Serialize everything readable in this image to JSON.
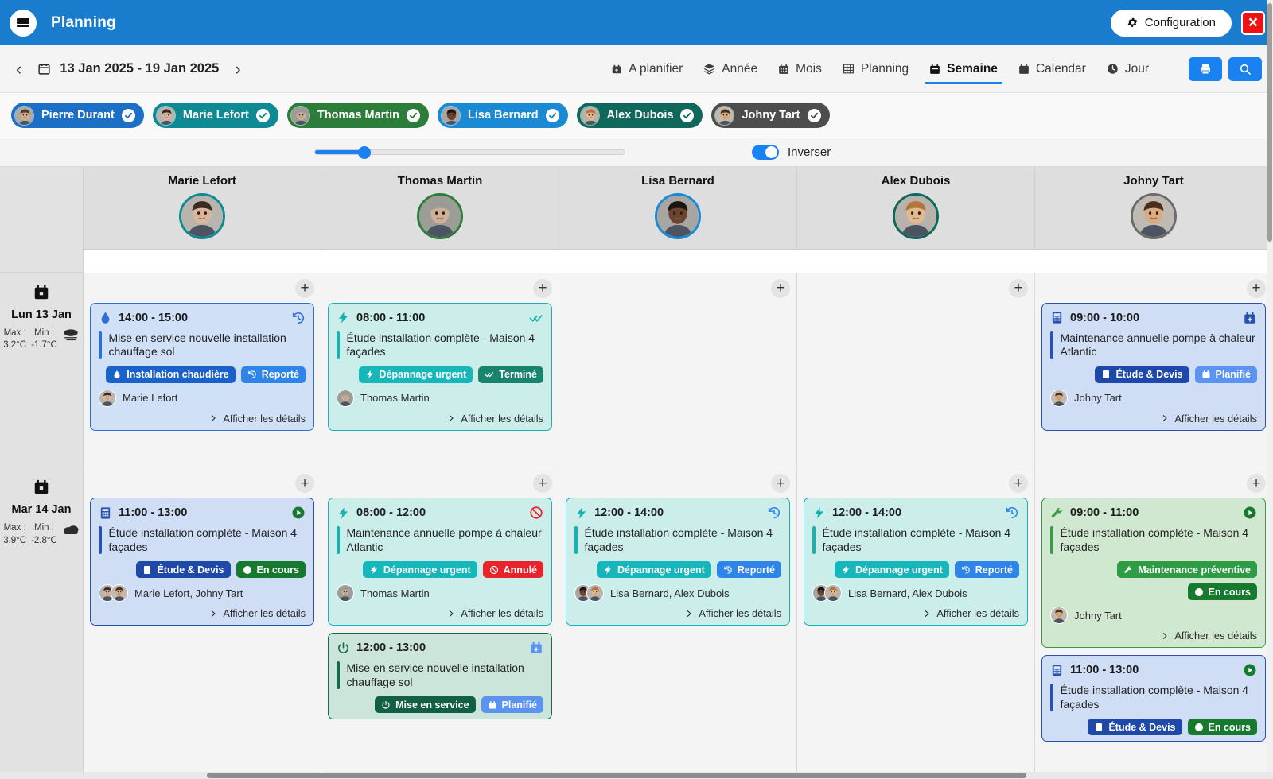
{
  "topbar": {
    "title": "Planning",
    "config_label": "Configuration",
    "close_label": "×",
    "bg_color": "#1a7ccc"
  },
  "nav": {
    "prev_label": "‹",
    "next_label": "›",
    "date_range": "13 Jan 2025 - 19 Jan 2025",
    "views": [
      {
        "label": "A planifier",
        "icon": "calendar-plus-icon",
        "active": false
      },
      {
        "label": "Année",
        "icon": "layers-icon",
        "active": false
      },
      {
        "label": "Mois",
        "icon": "calendar-grid-icon",
        "active": false
      },
      {
        "label": "Planning",
        "icon": "table-icon",
        "active": false
      },
      {
        "label": "Semaine",
        "icon": "calendar-week-icon",
        "active": true
      },
      {
        "label": "Calendar",
        "icon": "calendar-icon",
        "active": false
      },
      {
        "label": "Jour",
        "icon": "clock-icon",
        "active": false
      }
    ],
    "print_icon": "printer-icon",
    "search_icon": "search-icon",
    "accent_color": "#1a82f0"
  },
  "chips": [
    {
      "name": "Pierre Durant",
      "color": "#1b6fc4",
      "checked": true
    },
    {
      "name": "Marie Lefort",
      "color": "#0d8a94",
      "checked": true
    },
    {
      "name": "Thomas Martin",
      "color": "#2c7d3a",
      "checked": true
    },
    {
      "name": "Lisa Bernard",
      "color": "#1a8ad4",
      "checked": true
    },
    {
      "name": "Alex Dubois",
      "color": "#10685c",
      "checked": true
    },
    {
      "name": "Johny Tart",
      "color": "#4d4d4d",
      "checked": true
    }
  ],
  "controls": {
    "zoom_value": 18,
    "inverser_label": "Inverser",
    "inverser_on": true
  },
  "columns": [
    {
      "name": "Marie Lefort",
      "ring": "#0d8a94"
    },
    {
      "name": "Thomas Martin",
      "ring": "#2c7d3a"
    },
    {
      "name": "Lisa Bernard",
      "ring": "#1a8ad4"
    },
    {
      "name": "Alex Dubois",
      "ring": "#10685c"
    },
    {
      "name": "Johny Tart",
      "ring": "#6b6b6b"
    }
  ],
  "days": [
    {
      "label": "Lun 13 Jan",
      "max_label": "Max :",
      "min_label": "Min :",
      "max": "3.2°C",
      "min": "-1.7°C",
      "weather_icon": "fog-cloud-icon"
    },
    {
      "label": "Mar 14 Jan",
      "max_label": "Max :",
      "min_label": "Min :",
      "max": "3.9°C",
      "min": "-2.8°C",
      "weather_icon": "cloud-icon"
    }
  ],
  "add_label": "+",
  "details_label": "Afficher les détails",
  "rows": [
    {
      "day": 0,
      "cells": [
        {
          "cards": [
            {
              "time": "14:00 - 15:00",
              "title": "Mise en service nouvelle installation chauffage sol",
              "type_tag": "Installation chaudière",
              "type_icon": "water-drop-icon",
              "status_tag": "Reporté",
              "status_icon": "history-icon",
              "assignees": "Marie Lefort",
              "avatars": [
                "marie"
              ],
              "bg": "#cfe0f7",
              "border": "#2f6fd0",
              "accent": "#2f6fd0",
              "type_color": "#1a62c9",
              "status_color": "#2f84e8",
              "icon_color": "#2f6fd0"
            }
          ]
        },
        {
          "cards": [
            {
              "time": "08:00 - 11:00",
              "title": "Étude installation complète - Maison 4 façades",
              "type_tag": "Dépannage urgent",
              "type_icon": "bolt-icon",
              "status_tag": "Terminé",
              "status_icon": "double-check-icon",
              "assignees": "Thomas Martin",
              "avatars": [
                "thomas"
              ],
              "bg": "#cceeea",
              "border": "#15b2b0",
              "accent": "#15b2b0",
              "type_color": "#17b6bb",
              "status_color": "#16856b",
              "icon_color": "#15b2b0"
            }
          ]
        },
        {
          "cards": []
        },
        {
          "cards": []
        },
        {
          "cards": [
            {
              "time": "09:00 - 10:00",
              "title": "Maintenance annuelle pompe à chaleur Atlantic",
              "type_tag": "Étude & Devis",
              "type_icon": "calculator-icon",
              "status_tag": "Planifié",
              "status_icon": "calendar-plus-icon",
              "assignees": "Johny Tart",
              "avatars": [
                "johny"
              ],
              "bg": "#cfddf5",
              "border": "#2851b0",
              "accent": "#2851b0",
              "type_color": "#1f49a8",
              "status_color": "#5b94f0",
              "icon_color": "#2851b0"
            }
          ]
        }
      ]
    },
    {
      "day": 1,
      "cells": [
        {
          "cards": [
            {
              "time": "11:00 - 13:00",
              "title": "Étude installation complète - Maison 4 façades",
              "type_tag": "Étude & Devis",
              "type_icon": "calculator-icon",
              "status_tag": "En cours",
              "status_icon": "play-circle-icon",
              "assignees": "Marie Lefort, Johny Tart",
              "avatars": [
                "marie",
                "johny"
              ],
              "bg": "#cfddf5",
              "border": "#2851b0",
              "accent": "#2851b0",
              "type_color": "#1f49a8",
              "status_color": "#167a2e",
              "icon_color": "#2851b0",
              "status_ic_color": "#167a2e"
            }
          ]
        },
        {
          "cards": [
            {
              "time": "08:00 - 12:00",
              "title": "Maintenance annuelle pompe à chaleur Atlantic",
              "type_tag": "Dépannage urgent",
              "type_icon": "bolt-icon",
              "status_tag": "Annulé",
              "status_icon": "cancel-icon",
              "assignees": "Thomas Martin",
              "avatars": [
                "thomas"
              ],
              "bg": "#cceeea",
              "border": "#15b2b0",
              "accent": "#15b2b0",
              "type_color": "#17b6bb",
              "status_color": "#e8232a",
              "icon_color": "#15b2b0",
              "status_ic_color": "#e8232a"
            },
            {
              "time": "12:00 - 13:00",
              "title": "Mise en service nouvelle installation chauffage sol",
              "type_tag": "Mise en service",
              "type_icon": "power-icon",
              "status_tag": "Planifié",
              "status_icon": "calendar-plus-icon",
              "assignees": "",
              "avatars": [],
              "bg": "#cce5da",
              "border": "#166b4a",
              "accent": "#166b4a",
              "type_color": "#116045",
              "status_color": "#5b94f0",
              "icon_color": "#166b4a",
              "status_ic_color": "#5b94f0"
            }
          ]
        },
        {
          "cards": [
            {
              "time": "12:00 - 14:00",
              "title": "Étude installation complète - Maison 4 façades",
              "type_tag": "Dépannage urgent",
              "type_icon": "bolt-icon",
              "status_tag": "Reporté",
              "status_icon": "history-icon",
              "assignees": "Lisa Bernard, Alex Dubois",
              "avatars": [
                "lisa",
                "alex"
              ],
              "bg": "#cceeea",
              "border": "#15b2b0",
              "accent": "#15b2b0",
              "type_color": "#17b6bb",
              "status_color": "#2f84e8",
              "icon_color": "#15b2b0",
              "status_ic_color": "#2f84e8"
            }
          ]
        },
        {
          "cards": [
            {
              "time": "12:00 - 14:00",
              "title": "Étude installation complète - Maison 4 façades",
              "type_tag": "Dépannage urgent",
              "type_icon": "bolt-icon",
              "status_tag": "Reporté",
              "status_icon": "history-icon",
              "assignees": "Lisa Bernard, Alex Dubois",
              "avatars": [
                "lisa",
                "alex"
              ],
              "bg": "#cceeea",
              "border": "#15b2b0",
              "accent": "#15b2b0",
              "type_color": "#17b6bb",
              "status_color": "#2f84e8",
              "icon_color": "#15b2b0",
              "status_ic_color": "#2f84e8"
            }
          ]
        },
        {
          "cards": [
            {
              "time": "09:00 - 11:00",
              "title": "Étude installation complète - Maison 4 façades",
              "type_tag": "Maintenance préventive",
              "type_icon": "wrench-icon",
              "status_tag": "En cours",
              "status_icon": "play-circle-icon",
              "assignees": "Johny Tart",
              "avatars": [
                "johny"
              ],
              "bg": "#cfe8cf",
              "border": "#3a9b46",
              "accent": "#3a9b46",
              "type_color": "#2e9c45",
              "status_color": "#167a2e",
              "icon_color": "#3a9b46",
              "status_ic_color": "#167a2e"
            },
            {
              "time": "11:00 - 13:00",
              "title": "Étude installation complète - Maison 4 façades",
              "type_tag": "Étude & Devis",
              "type_icon": "calculator-icon",
              "status_tag": "En cours",
              "status_icon": "play-circle-icon",
              "assignees": "",
              "avatars": [],
              "bg": "#cfddf5",
              "border": "#2851b0",
              "accent": "#2851b0",
              "type_color": "#1f49a8",
              "status_color": "#167a2e",
              "icon_color": "#2851b0",
              "status_ic_color": "#167a2e"
            }
          ]
        }
      ]
    }
  ]
}
